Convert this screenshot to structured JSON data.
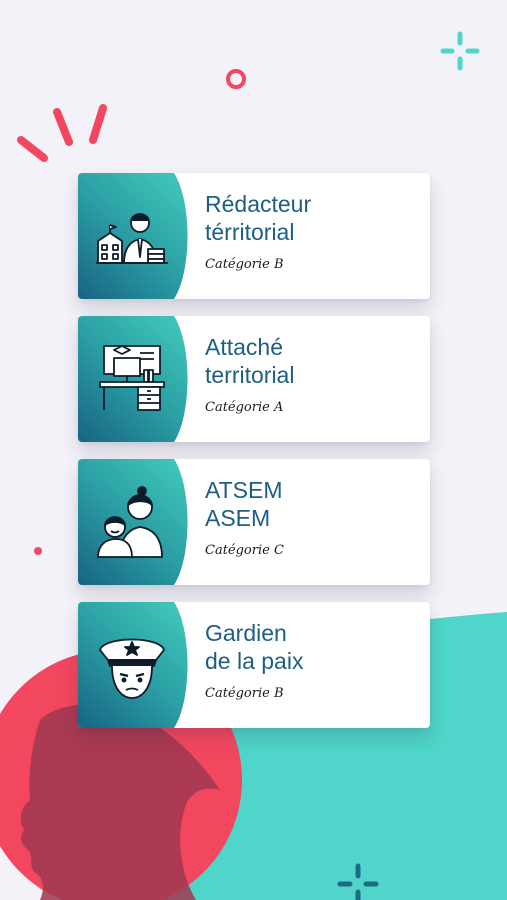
{
  "colors": {
    "background": "#f3f2f8",
    "teal": "#4fd5c9",
    "coral": "#f3475f",
    "dark_teal": "#1c6f8a",
    "title_blue": "#1d5f82"
  },
  "cards": [
    {
      "title_line1": "Rédacteur",
      "title_line2": "térritorial",
      "category": "Catégorie B",
      "icon": "administrator-icon"
    },
    {
      "title_line1": "Attaché",
      "title_line2": "territorial",
      "category": "Catégorie A",
      "icon": "office-desk-icon"
    },
    {
      "title_line1": "ATSEM",
      "title_line2": "ASEM",
      "category": "Catégorie C",
      "icon": "mother-child-icon"
    },
    {
      "title_line1": "Gardien",
      "title_line2": "de la paix",
      "category": "Catégorie B",
      "icon": "police-officer-icon"
    }
  ]
}
